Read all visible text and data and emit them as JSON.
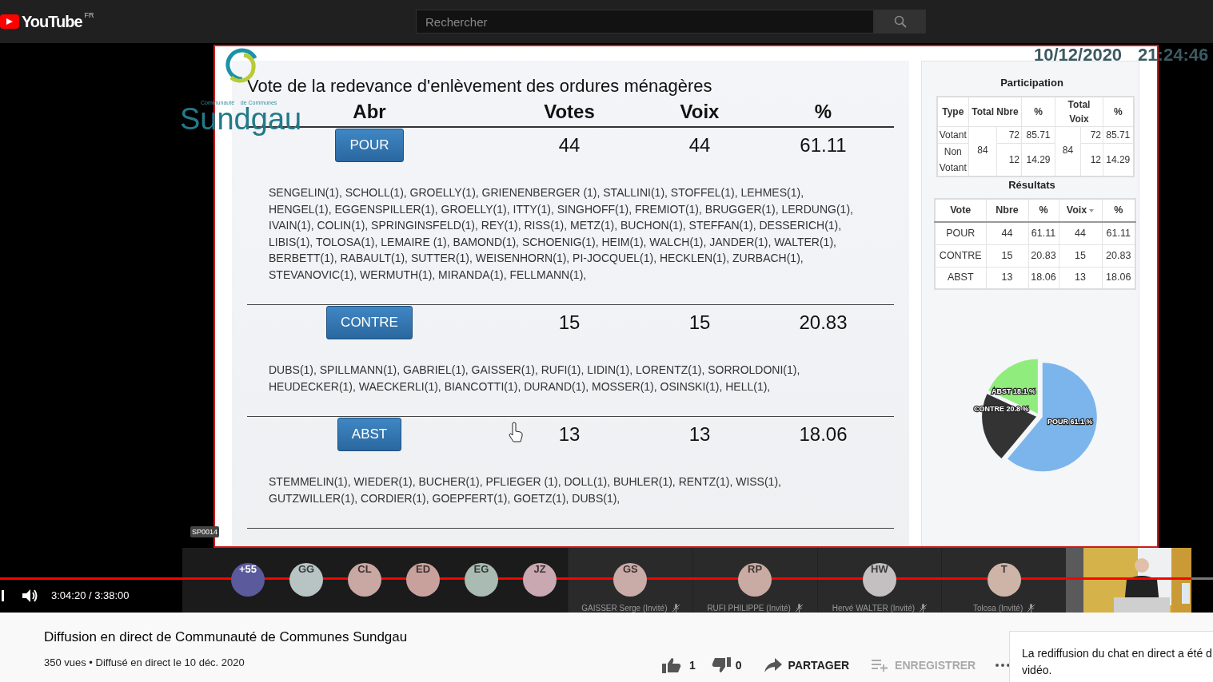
{
  "topbar": {
    "logo": "YouTube",
    "region": "FR",
    "search": {
      "placeholder": "Rechercher"
    }
  },
  "player": {
    "timestamp": {
      "date": "10/12/2020",
      "time": "21:24:46"
    },
    "logo": {
      "caption": "Communauté    de Communes",
      "name": "Sundgau"
    },
    "slide": {
      "title": "Vote de la redevance d'enlèvement des ordures ménagères",
      "columns": [
        "Abr",
        "Votes",
        "Voix",
        "%"
      ],
      "groups": [
        {
          "label": "POUR",
          "votes": "44",
          "voix": "44",
          "percent": "61.11",
          "names": [
            "SENGELIN(1), SCHOLL(1), GROELLY(1), GRIENENBERGER (1), STALLINI(1), STOFFEL(1), LEHMES(1),",
            "HENGEL(1), EGGENSPILLER(1), GROELLY(1), ITTY(1), SINGHOFF(1), FREMIOT(1), BRUGGER(1), LERDUNG(1),",
            "IVAIN(1), COLIN(1), SPRINGINSFELD(1), REY(1), RISS(1), METZ(1), BUCHON(1), STEFFAN(1), DESSERICH(1),",
            "LIBIS(1), TOLOSA(1), LEMAIRE (1), BAMOND(1), SCHOENIG(1), HEIM(1), WALCH(1), JANDER(1), WALTER(1),",
            "BERBETT(1), RABAULT(1), SUTTER(1), WEISENHORN(1), PI-JOCQUEL(1), HECKLEN(1), ZURBACH(1),",
            "STEVANOVIC(1), WERMUTH(1), MIRANDA(1), FELLMANN(1),"
          ]
        },
        {
          "label": "CONTRE",
          "votes": "15",
          "voix": "15",
          "percent": "20.83",
          "names": [
            "DUBS(1), SPILLMANN(1), GABRIEL(1), GAISSER(1), RUFI(1), LIDIN(1), LORENTZ(1), SORROLDONI(1),",
            "HEUDECKER(1), WAECKERLI(1), BIANCOTTI(1), DURAND(1), MOSSER(1), OSINSKI(1), HELL(1),"
          ]
        },
        {
          "label": "ABST",
          "votes": "13",
          "voix": "13",
          "percent": "18.06",
          "names": [
            "STEMMELIN(1), WIEDER(1), BUCHER(1), PFLIEGER (1), DOLL(1), BUHLER(1), RENTZ(1), WISS(1),",
            "GUTZWILLER(1), CORDIER(1), GOEPFERT(1), GOETZ(1), DUBS(1),"
          ]
        }
      ]
    },
    "side_panel": {
      "participation": {
        "title": "Participation",
        "columns": [
          "Type",
          "Total Nbre",
          "%",
          "Total Voix",
          "%"
        ],
        "total_nbre": "84",
        "total_voix": "84",
        "rows": [
          {
            "type": "Votant",
            "nbre": "72",
            "pct": "85.71",
            "voix": "72",
            "pct2": "85.71"
          },
          {
            "type": "Non Votant",
            "nbre": "12",
            "pct": "14.29",
            "voix": "12",
            "pct2": "14.29"
          }
        ]
      },
      "results": {
        "title": "Résultats",
        "columns": [
          {
            "label": "Vote",
            "sorted": false
          },
          {
            "label": "Nbre",
            "sorted": false
          },
          {
            "label": "%",
            "sorted": false
          },
          {
            "label": "Voix",
            "sorted": true
          },
          {
            "label": "%",
            "sorted": false
          }
        ],
        "rows": [
          [
            "POUR",
            "44",
            "61.11",
            "44",
            "61.11"
          ],
          [
            "CONTRE",
            "15",
            "20.83",
            "15",
            "20.83"
          ],
          [
            "ABST",
            "13",
            "18.06",
            "13",
            "18.06"
          ]
        ]
      },
      "chart_data": {
        "type": "pie",
        "categories": [
          "POUR",
          "CONTRE",
          "ABST"
        ],
        "values": [
          61.1,
          20.8,
          18.1
        ],
        "colors": [
          "#7cb5ec",
          "#333333",
          "#90ed7d"
        ],
        "value_labels": [
          "61.1 %",
          "20.8 %",
          "18.1 %"
        ]
      }
    },
    "screen_label": "SP0014",
    "participants": [
      {
        "initials": "+55",
        "color": "#5a5a9c"
      },
      {
        "initials": "GG",
        "color": "#b8c4c4"
      },
      {
        "initials": "CL",
        "color": "#c9a7a2"
      },
      {
        "initials": "ED",
        "color": "#c9a19c"
      },
      {
        "initials": "EG",
        "color": "#a9bbb2"
      },
      {
        "initials": "JZ",
        "color": "#c9a8b1"
      },
      {
        "initials": "GS",
        "color": "#c9aba7",
        "name": "GAISSER Serge (Invité)",
        "muted": true
      },
      {
        "initials": "RP",
        "color": "#c9aba3",
        "name": "RUFI PHILIPPE (Invité)",
        "muted": true
      },
      {
        "initials": "HW",
        "color": "#c4c0c2",
        "name": "Hervé WALTER (Invité)",
        "muted": true
      },
      {
        "initials": "T",
        "color": "#cdb4a6",
        "name": "Tolosa (Invité)",
        "muted": true
      }
    ],
    "progress": {
      "level": 0.982
    },
    "time": "3:04:20 / 3:38:00"
  },
  "video": {
    "title": "Diffusion en direct de Communauté de Communes Sundgau",
    "meta": "350 vues • Diffusé en direct le 10 déc. 2020",
    "likes": "1",
    "dislikes": "0",
    "actions": [
      {
        "kind": "share",
        "label": "PARTAGER",
        "disabled": false
      },
      {
        "kind": "save",
        "label": "ENREGISTRER",
        "disabled": true
      }
    ]
  },
  "chat": {
    "lines": [
      "La rediffusion du chat en direct a été d",
      "vidéo."
    ]
  }
}
